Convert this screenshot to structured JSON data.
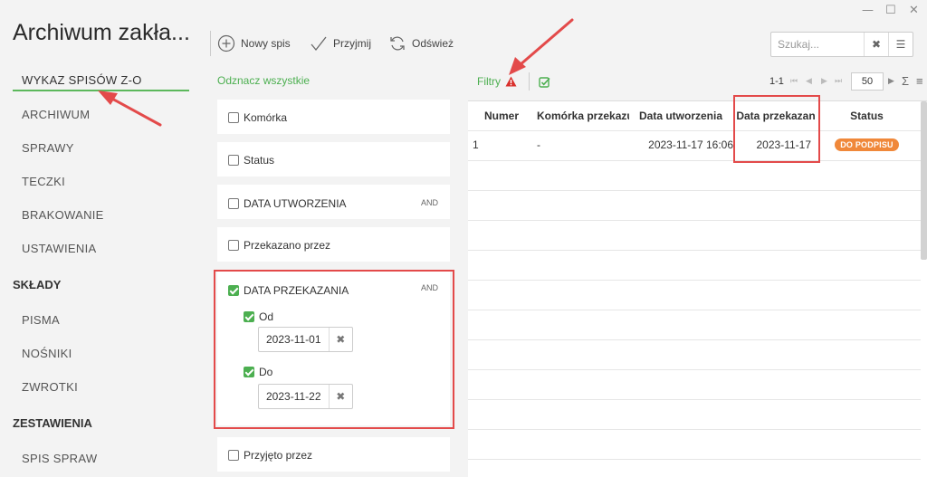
{
  "window": {
    "minimize": "—",
    "maximize": "☐",
    "close": "✕"
  },
  "app": {
    "title": "Archiwum zakła..."
  },
  "sidebar": {
    "items": [
      {
        "label": "WYKAZ SPISÓW Z-O"
      },
      {
        "label": "ARCHIWUM"
      },
      {
        "label": "SPRAWY"
      },
      {
        "label": "TECZKI"
      },
      {
        "label": "BRAKOWANIE"
      },
      {
        "label": "USTAWIENIA"
      }
    ],
    "group_sklady": "SKŁADY",
    "sklady_items": [
      {
        "label": "PISMA"
      },
      {
        "label": "NOŚNIKI"
      },
      {
        "label": "ZWROTKI"
      }
    ],
    "group_zestawienia": "ZESTAWIENIA",
    "zestawienia_items": [
      {
        "label": "SPIS SPRAW"
      }
    ]
  },
  "toolbar": {
    "new_label": "Nowy spis",
    "accept_label": "Przyjmij",
    "refresh_label": "Odśwież"
  },
  "search": {
    "placeholder": "Szukaj...",
    "value": ""
  },
  "filters": {
    "unmark_all": "Odznacz wszystkie",
    "komorka": "Komórka",
    "status": "Status",
    "data_utworzenia": "DATA UTWORZENIA",
    "przekazano_przez": "Przekazano przez",
    "data_przekazania": "DATA PRZEKAZANIA",
    "and_label": "AND",
    "od_label": "Od",
    "od_value": "2023-11-01",
    "do_label": "Do",
    "do_value": "2023-11-22",
    "przyjeto_przez": "Przyjęto przez"
  },
  "table_toolbar": {
    "filtry_label": "Filtry",
    "range": "1-1",
    "page_size": "50",
    "sum_icon": "Σ",
    "menu_icon": "≡"
  },
  "table": {
    "columns": [
      "Numer",
      "Komórka przekazu",
      "Data utworzenia",
      "Data przekazan",
      "Status"
    ],
    "rows": [
      {
        "numer": "1",
        "komorka": "-",
        "data_utworzenia": "2023-11-17 16:06",
        "data_przekazania": "2023-11-17",
        "status": "DO PODPISU"
      }
    ]
  },
  "colors": {
    "accent": "#4caf50",
    "annotation": "#e34a4a",
    "badge": "#f0883a"
  }
}
